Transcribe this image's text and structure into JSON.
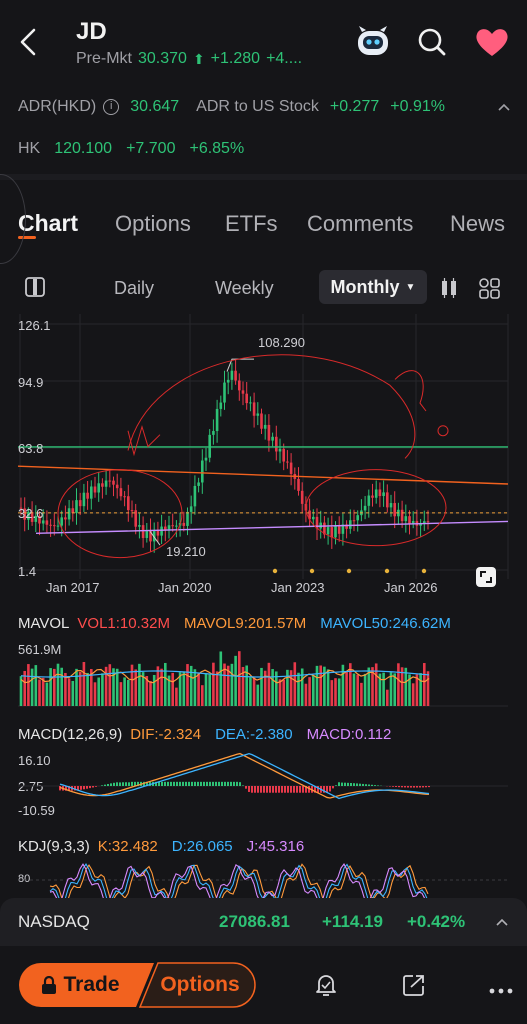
{
  "header": {
    "symbol": "JD",
    "premkt_label": "Pre-Mkt",
    "premkt_price": "30.370",
    "premkt_change": "+1.280",
    "premkt_pct": "+4...."
  },
  "adr": {
    "label": "ADR(HKD)",
    "value": "30.647",
    "to_us_label": "ADR to US Stock",
    "to_us_change": "+0.277",
    "to_us_pct": "+0.91%"
  },
  "hk": {
    "label": "HK",
    "price": "120.100",
    "change": "+7.700",
    "pct": "+6.85%"
  },
  "tabs": [
    "Chart",
    "Options",
    "ETFs",
    "Comments",
    "News"
  ],
  "periods": {
    "daily": "Daily",
    "weekly": "Weekly",
    "monthly": "Monthly"
  },
  "chart_data": {
    "type": "candlestick",
    "y_ticks": [
      "126.1",
      "94.9",
      "63.8",
      "32.6",
      "1.4"
    ],
    "x_ticks": [
      "Jan 2017",
      "Jan 2020",
      "Jan 2023",
      "Jan 2026"
    ],
    "annotations": {
      "high": "108.290",
      "low": "19.210"
    },
    "ylim": [
      1.4,
      126.1
    ]
  },
  "mavol": {
    "label": "MAVOL",
    "vol1": "VOL1:10.32M",
    "mavol9": "MAVOL9:201.57M",
    "mavol50": "MAVOL50:246.62M",
    "max": "561.9M"
  },
  "macd": {
    "label": "MACD(12,26,9)",
    "dif": "DIF:-2.324",
    "dea": "DEA:-2.380",
    "macd": "MACD:0.112",
    "ticks": [
      "16.10",
      "2.75",
      "-10.59"
    ]
  },
  "kdj": {
    "label": "KDJ(9,3,3)",
    "k": "K:32.482",
    "d": "D:26.065",
    "j": "J:45.316",
    "tick": "80"
  },
  "index_bar": {
    "name": "NASDAQ",
    "value": "27086.81",
    "change": "+114.19",
    "pct": "+0.42%"
  },
  "bottom": {
    "trade": "Trade",
    "options": "Options"
  },
  "colors": {
    "up": "#2ec276",
    "down": "#e8394a",
    "accent": "#f2621f",
    "bg": "#151518"
  }
}
